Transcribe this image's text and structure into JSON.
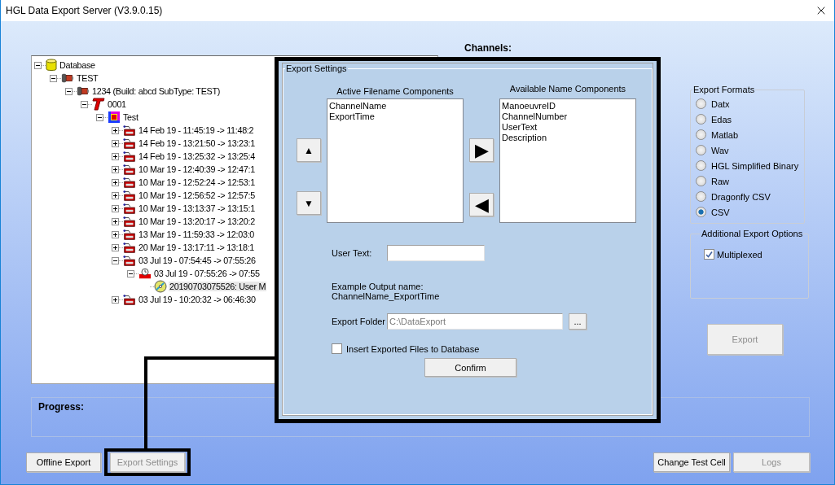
{
  "window": {
    "title": "HGL Data Export Server (V3.9.0.15)"
  },
  "tree": [
    {
      "label": "Database",
      "kind": "database",
      "expanded": true,
      "selected": false,
      "children": [
        {
          "label": "TEST",
          "kind": "unit",
          "expanded": true,
          "selected": false,
          "children": [
            {
              "label": "1234 (Build: abcd  SubType: TEST)",
              "kind": "unit",
              "expanded": true,
              "selected": false,
              "children": [
                {
                  "label": "0001",
                  "kind": "cell",
                  "expanded": true,
                  "selected": false,
                  "children": [
                    {
                      "label": "Test",
                      "kind": "test",
                      "expanded": true,
                      "selected": false,
                      "children": [
                        {
                          "label": "14 Feb 19 - 11:45:19 -> 11:48:2",
                          "kind": "recording",
                          "expanded": false,
                          "selected": false
                        },
                        {
                          "label": "14 Feb 19 - 13:21:50 -> 13:23:1",
                          "kind": "recording",
                          "expanded": false,
                          "selected": false
                        },
                        {
                          "label": "14 Feb 19 - 13:25:32 -> 13:25:4",
                          "kind": "recording",
                          "expanded": false,
                          "selected": false
                        },
                        {
                          "label": "10 Mar 19 - 12:40:39 -> 12:47:1",
                          "kind": "recording",
                          "expanded": false,
                          "selected": false
                        },
                        {
                          "label": "10 Mar 19 - 12:52:24 -> 12:53:1",
                          "kind": "recording",
                          "expanded": false,
                          "selected": false
                        },
                        {
                          "label": "10 Mar 19 - 12:56:52 -> 12:57:5",
                          "kind": "recording",
                          "expanded": false,
                          "selected": false
                        },
                        {
                          "label": "10 Mar 19 - 13:13:37 -> 13:15:1",
                          "kind": "recording",
                          "expanded": false,
                          "selected": false
                        },
                        {
                          "label": "10 Mar 19 - 13:20:17 -> 13:20:2",
                          "kind": "recording",
                          "expanded": false,
                          "selected": false
                        },
                        {
                          "label": "13 Mar 19 - 11:59:33 -> 12:03:0",
                          "kind": "recording",
                          "expanded": false,
                          "selected": false
                        },
                        {
                          "label": "20 Mar 19 - 13:17:11 -> 13:18:1",
                          "kind": "recording",
                          "expanded": false,
                          "selected": false
                        },
                        {
                          "label": "03 Jul 19 - 07:54:45 -> 07:55:26",
                          "kind": "recording",
                          "expanded": true,
                          "selected": false,
                          "children": [
                            {
                              "label": "03 Jul 19 - 07:55:26 -> 07:55",
                              "kind": "event",
                              "expanded": true,
                              "selected": false,
                              "children": [
                                {
                                  "label": "20190703075526: User M",
                                  "kind": "file",
                                  "selected": true
                                }
                              ]
                            }
                          ]
                        },
                        {
                          "label": "03 Jul 19 - 10:20:32 -> 06:46:30",
                          "kind": "recording",
                          "expanded": false,
                          "selected": false
                        }
                      ]
                    }
                  ]
                }
              ]
            }
          ]
        }
      ]
    }
  ],
  "channels_label": "Channels:",
  "export_settings": {
    "title": "Export Settings",
    "active_label": "Active Filename Components",
    "active_items": [
      "ChannelName",
      "ExportTime"
    ],
    "available_label": "Available Name Components",
    "available_items": [
      "ManoeuvreID",
      "ChannelNumber",
      "UserText",
      "Description"
    ],
    "up_button": "▲",
    "down_button": "▼",
    "add_button": "▶",
    "remove_button": "◀",
    "user_text_label": "User Text:",
    "example_label": "Example Output name:",
    "example_value": "ChannelName_ExportTime",
    "folder_label": "Export Folder",
    "folder_value": "C:\\DataExport",
    "folder_disabled": true,
    "browse_button": "...",
    "insert_option": {
      "label": "Insert Exported Files to Database",
      "checked": false
    },
    "confirm_button": "Confirm"
  },
  "export_formats": {
    "title": "Export Formats",
    "options": [
      {
        "label": "Datx",
        "selected": false
      },
      {
        "label": "Edas",
        "selected": false
      },
      {
        "label": "Matlab",
        "selected": false
      },
      {
        "label": "Wav",
        "selected": false
      },
      {
        "label": "HGL Simplified Binary",
        "selected": false
      },
      {
        "label": "Raw",
        "selected": false
      },
      {
        "label": "Dragonfly CSV",
        "selected": false
      },
      {
        "label": "CSV",
        "selected": true
      }
    ]
  },
  "additional_options": {
    "title": "Additional Export Options",
    "options": [
      {
        "label": "Multiplexed",
        "checked": true
      }
    ]
  },
  "export_button": {
    "label": "Export",
    "disabled": true
  },
  "progress": {
    "label": "Progress:"
  },
  "bottom_left_buttons": [
    {
      "label": "Offline Export",
      "disabled": false,
      "outlined": false
    },
    {
      "label": "Export Settings",
      "disabled": true,
      "outlined": true
    }
  ],
  "bottom_right_buttons": [
    {
      "label": "Change Test Cell",
      "disabled": false
    },
    {
      "label": "Logs",
      "disabled": true
    }
  ]
}
